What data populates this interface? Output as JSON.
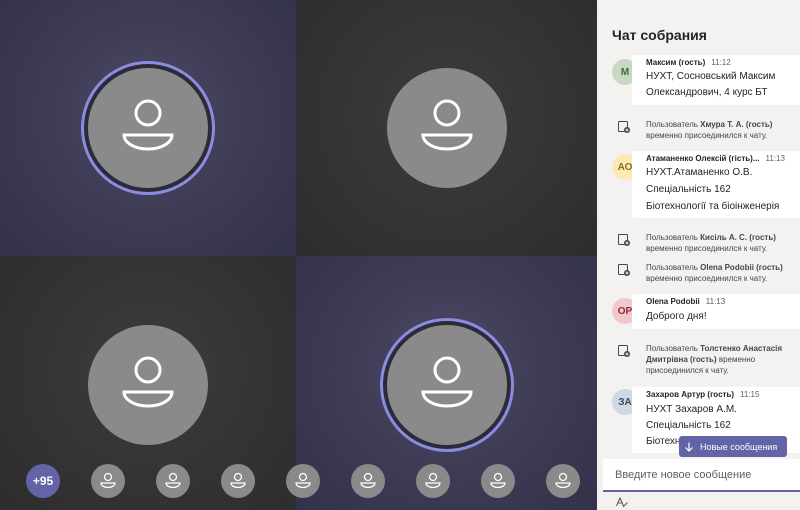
{
  "grid": {
    "tiles": [
      {
        "name": "participant-tile-1",
        "speaking": true
      },
      {
        "name": "participant-tile-2",
        "speaking": false
      },
      {
        "name": "participant-tile-3",
        "speaking": false
      },
      {
        "name": "participant-tile-4",
        "speaking": true
      }
    ]
  },
  "strip": {
    "more_count": "+95"
  },
  "chat": {
    "title": "Чат собрания",
    "messages": [
      {
        "initials": "М",
        "sender": "Максим (гость)",
        "time": "11:12",
        "lines": [
          "НУХТ, Сосновський Максим",
          "Олександрович, 4 курс БТ"
        ],
        "avatar_bg": "#c8d9c3",
        "avatar_fg": "#3b6b35"
      },
      {
        "initials": "АО",
        "sender": "Атаманенко Олексій (гість)...",
        "time": "11:13",
        "lines": [
          "НУХТ.Атаманенко О.В.",
          "Спеціальність 162",
          "Біотехнології та біоінженерія"
        ],
        "avatar_bg": "#fbe9b6",
        "avatar_fg": "#8a6d1f"
      },
      {
        "initials": "OP",
        "sender": "Olena Podobii",
        "time": "11:13",
        "lines": [
          "Доброго дня!"
        ],
        "avatar_bg": "#f1c8cc",
        "avatar_fg": "#8e2c36"
      },
      {
        "initials": "ЗА",
        "sender": "Захаров Артур (гость)",
        "time": "11:15",
        "lines": [
          "НУХТ Захаров А.М.",
          "Спеціальність 162",
          "Біотехн"
        ],
        "avatar_bg": "#cfd8e3",
        "avatar_fg": "#3a4b60"
      }
    ],
    "system": [
      {
        "prefix": "Пользователь ",
        "name": "Хмура Т. А. (гость)",
        "rest": "временно присоединился к чату."
      },
      {
        "prefix": "Пользователь ",
        "name": "Кисіль А. С. (гость)",
        "rest": "временно присоединился к чату."
      },
      {
        "prefix": "Пользователь ",
        "name": "Olena Podobii (гость)",
        "rest": "временно присоединился к чату."
      },
      {
        "prefix": "Пользователь ",
        "name": "Толстенко Анастасія Дмитрівна (гость)",
        "rest": " временно присоединился к чату."
      }
    ],
    "new_messages_label": "Новые сообщения",
    "compose_placeholder": "Введите новое сообщение"
  },
  "colors": {
    "accent": "#6264a7",
    "speaking_ring": "#8b8cdf",
    "avatar_gray": "#8a8a8a",
    "panel_bg": "#f3f2f1"
  },
  "icons": [
    "person-icon",
    "chat-join-icon",
    "arrow-down-icon",
    "format-icon"
  ]
}
